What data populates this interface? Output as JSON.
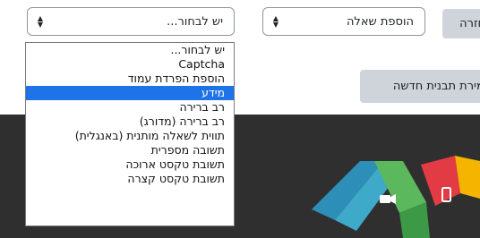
{
  "type_select": {
    "value": "יש לבחור..."
  },
  "add_question_select": {
    "value": "הוספת שאלה"
  },
  "return_button": {
    "label": "חזרה"
  },
  "save_template_button": {
    "label": "שמירת תבנית חדשה"
  },
  "dropdown": {
    "options": [
      {
        "label": "יש לבחור..."
      },
      {
        "label": "Captcha"
      },
      {
        "label": "הוספת הפרדת עמוד"
      },
      {
        "label": "מידע"
      },
      {
        "label": "רב ברירה"
      },
      {
        "label": "רב ברירה (מדורג)"
      },
      {
        "label": "תווית לשאלה מותנית (באנגלית)"
      },
      {
        "label": "תשובה מספרית"
      },
      {
        "label": "תשובת טקסט ארוכה"
      },
      {
        "label": "תשובת טקסט קצרה"
      }
    ],
    "selected_label": "מידע"
  },
  "icons": {
    "select_arrows": "sort-arrows-icon",
    "camera": "video-camera-icon",
    "phone": "mobile-phone-icon"
  },
  "colors": {
    "footer_bg": "#2f2f30",
    "selected_bg": "#1e73e8",
    "button_bg": "#ced4da"
  }
}
